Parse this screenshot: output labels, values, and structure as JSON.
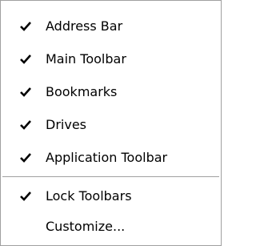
{
  "menu": {
    "items": [
      {
        "label": "Address Bar",
        "checked": true,
        "check_icon": "check-icon"
      },
      {
        "label": "Main Toolbar",
        "checked": true,
        "check_icon": "check-icon"
      },
      {
        "label": "Bookmarks",
        "checked": true,
        "check_icon": "check-icon"
      },
      {
        "label": "Drives",
        "checked": true,
        "check_icon": "check-icon"
      },
      {
        "label": "Application Toolbar",
        "checked": true,
        "check_icon": "check-icon"
      }
    ],
    "lower_items": [
      {
        "label": "Lock Toolbars",
        "checked": true,
        "check_icon": "check-icon"
      },
      {
        "label": "Customize...",
        "checked": false
      }
    ]
  }
}
